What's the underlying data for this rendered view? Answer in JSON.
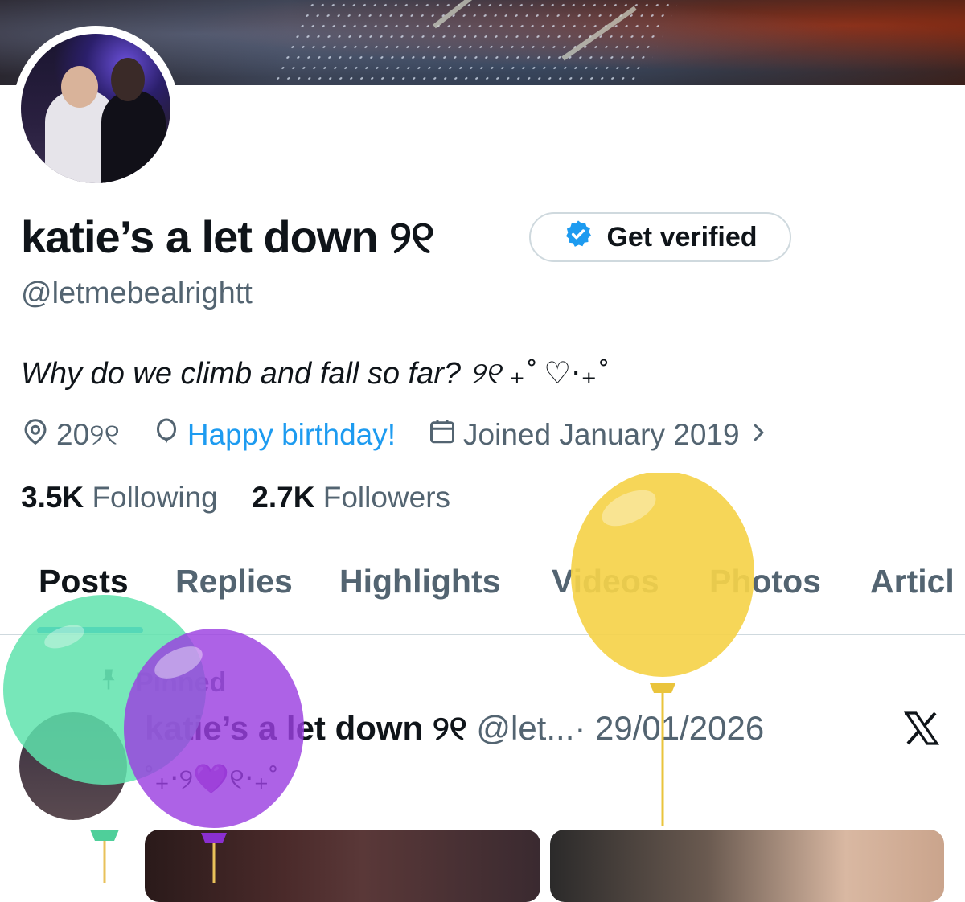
{
  "profile": {
    "display_name": "katie’s a let down ୨୧",
    "verify_label": "Get verified",
    "handle": "@letmebealrightt",
    "bio": "Why do we climb and fall so far? ୨୧ ₊˚ ♡⋅₊˚",
    "location": "20୨୧",
    "birthday": "Happy birthday!",
    "joined": "Joined January 2019",
    "following_count": "3.5K",
    "following_label": "Following",
    "followers_count": "2.7K",
    "followers_label": "Followers"
  },
  "tabs": [
    {
      "label": "Posts"
    },
    {
      "label": "Replies"
    },
    {
      "label": "Highlights"
    },
    {
      "label": "Videos"
    },
    {
      "label": "Photos"
    },
    {
      "label": "Articl"
    }
  ],
  "pinned_post": {
    "pinned_label": "Pinned",
    "author_name": "katie’s a let down ୨୧",
    "author_handle": "@let...",
    "date": "· 29/01/2026",
    "text": "˚₊‧୨💜୧‧₊˚"
  },
  "icons": {
    "location": "location-pin-icon",
    "birthday": "balloon-icon",
    "joined": "calendar-icon",
    "chevron": "chevron-right-icon",
    "verified": "verified-badge-icon",
    "pin": "pin-icon",
    "brand": "x-logo-icon"
  },
  "colors": {
    "accent": "#1d9bf0",
    "text_primary": "#0f1419",
    "text_secondary": "#536471",
    "border": "#cfd9de",
    "balloon_green": "#5fe3ad",
    "balloon_purple": "#9b3fe0",
    "balloon_yellow": "#f5d24a"
  }
}
